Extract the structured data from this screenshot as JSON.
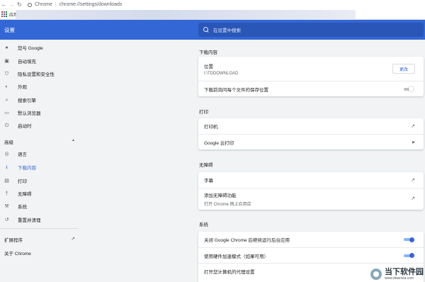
{
  "browser": {
    "app_name": "Chrome",
    "url": "chrome://settings/downloads",
    "bookmarks_apps_label": "应用"
  },
  "header": {
    "title": "设置",
    "search_placeholder": "在设置中搜索"
  },
  "sidebar": {
    "items": [
      {
        "label": "您与 Google",
        "icon": "person-icon"
      },
      {
        "label": "自动填充",
        "icon": "clipboard-icon"
      },
      {
        "label": "隐私设置和安全性",
        "icon": "shield-icon"
      },
      {
        "label": "外观",
        "icon": "palette-icon"
      },
      {
        "label": "搜索引擎",
        "icon": "search-icon"
      },
      {
        "label": "默认浏览器",
        "icon": "browser-window-icon"
      },
      {
        "label": "启动时",
        "icon": "power-icon"
      }
    ],
    "advanced_label": "高级",
    "advanced_items": [
      {
        "label": "语言",
        "icon": "globe-icon"
      },
      {
        "label": "下载内容",
        "icon": "download-icon",
        "active": true
      },
      {
        "label": "打印",
        "icon": "printer-icon"
      },
      {
        "label": "无障碍",
        "icon": "accessibility-icon"
      },
      {
        "label": "系统",
        "icon": "wrench-icon"
      },
      {
        "label": "重置并清理",
        "icon": "history-icon"
      }
    ],
    "extensions_label": "扩展程序",
    "about_label": "关于 Chrome"
  },
  "main": {
    "downloads": {
      "title": "下载内容",
      "location_label": "位置",
      "location_value": "I:\\TDDOWNLOAD",
      "change_button": "更改",
      "ask_label": "下载前询问每个文件的保存位置",
      "ask_enabled": false
    },
    "printing": {
      "title": "打印",
      "printers_label": "打印机",
      "cloud_print_label": "Google 云打印"
    },
    "accessibility": {
      "title": "无障碍",
      "captions_label": "字幕",
      "add_features_label": "添加无障碍功能",
      "add_features_sub": "打开 Chrome 网上应用店"
    },
    "system": {
      "title": "系统",
      "background_label": "关闭 Google Chrome 后继续运行后台应用",
      "background_enabled": true,
      "hw_accel_label": "使用硬件加速模式（如果可用）",
      "hw_accel_enabled": true,
      "proxy_label": "打开您计算机的代理设置"
    }
  },
  "watermark": {
    "brand": "当下软件园",
    "url": "www.downxia.com"
  },
  "colors": {
    "header_blue": "#3367d6",
    "toggle_on": "#3367d6",
    "active_nav": "#3367d6"
  }
}
